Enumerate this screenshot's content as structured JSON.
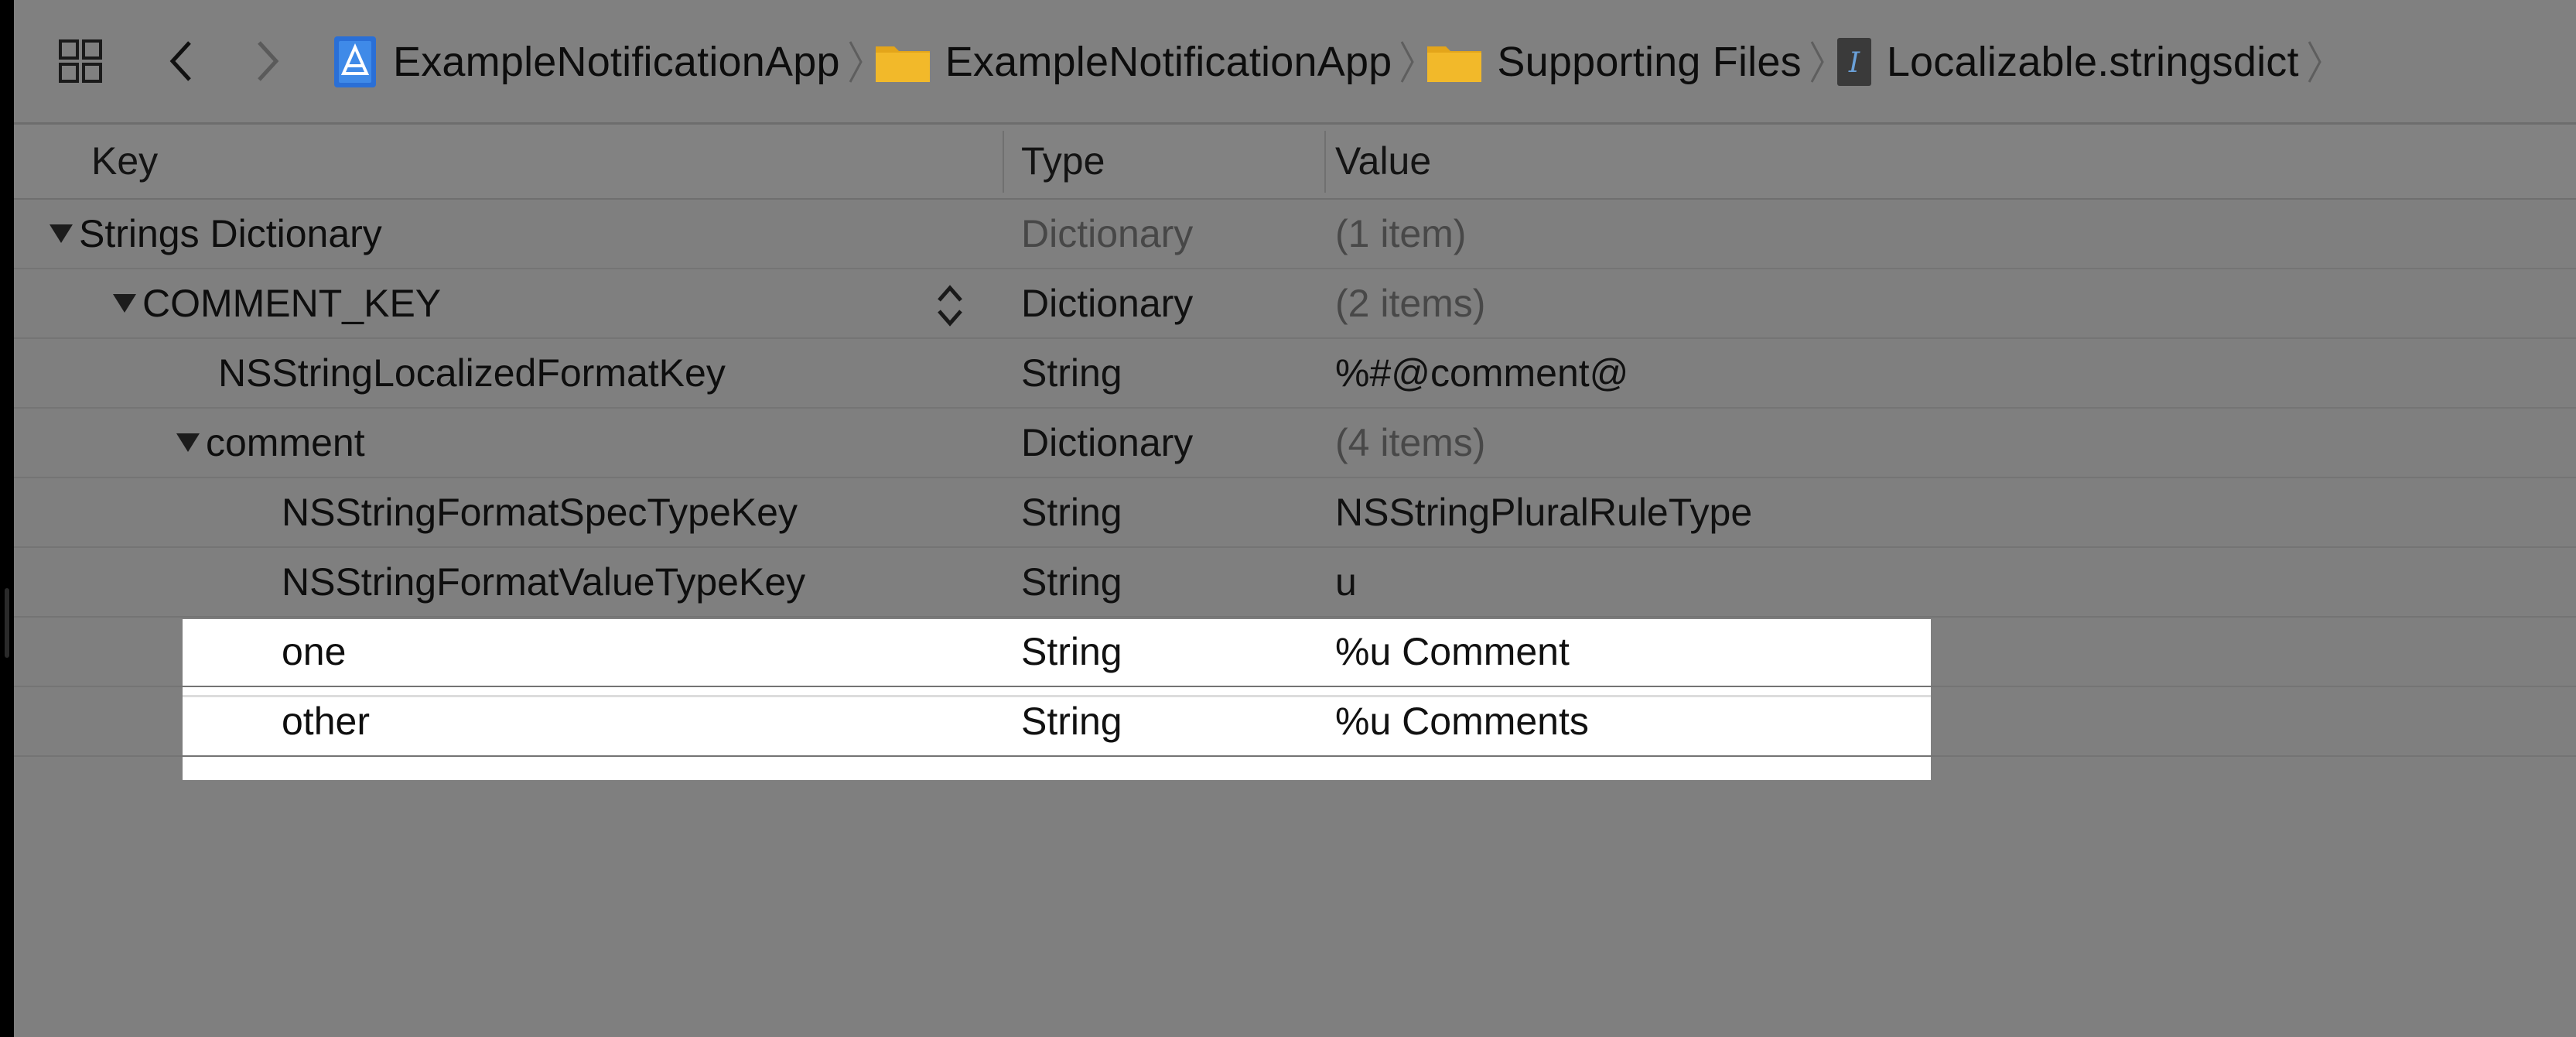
{
  "breadcrumb": [
    {
      "label": "ExampleNotificationApp",
      "icon": "app-project-icon"
    },
    {
      "label": "ExampleNotificationApp",
      "icon": "folder-icon"
    },
    {
      "label": "Supporting Files",
      "icon": "folder-icon"
    },
    {
      "label": "Localizable.stringsdict",
      "icon": "strings-file-icon"
    }
  ],
  "columns": {
    "key": "Key",
    "type": "Type",
    "value": "Value"
  },
  "rows": [
    {
      "key": "Strings Dictionary",
      "type": "Dictionary",
      "value": "(1 item)",
      "indent": 0,
      "disclosure": true,
      "dim": true
    },
    {
      "key": "COMMENT_KEY",
      "type": "Dictionary",
      "value": "(2 items)",
      "indent": 1,
      "disclosure": true,
      "dim": false,
      "value_dim": true
    },
    {
      "key": "NSStringLocalizedFormatKey",
      "type": "String",
      "value": "%#@comment@",
      "indent": 2,
      "disclosure": false
    },
    {
      "key": "comment",
      "type": "Dictionary",
      "value": "(4 items)",
      "indent": 2,
      "disclosure": true,
      "dim": false,
      "value_dim": true
    },
    {
      "key": "NSStringFormatSpecTypeKey",
      "type": "String",
      "value": "NSStringPluralRuleType",
      "indent": 3,
      "disclosure": false
    },
    {
      "key": "NSStringFormatValueTypeKey",
      "type": "String",
      "value": "u",
      "indent": 3,
      "disclosure": false
    },
    {
      "key": "one",
      "type": "String",
      "value": "%u Comment",
      "indent": 3,
      "disclosure": false,
      "highlighted": true
    },
    {
      "key": "other",
      "type": "String",
      "value": "%u Comments",
      "indent": 3,
      "disclosure": false,
      "highlighted": true
    }
  ],
  "colors": {
    "background": "#7f7f7f",
    "highlight": "#ffffff",
    "folder": "#e3a51a"
  }
}
